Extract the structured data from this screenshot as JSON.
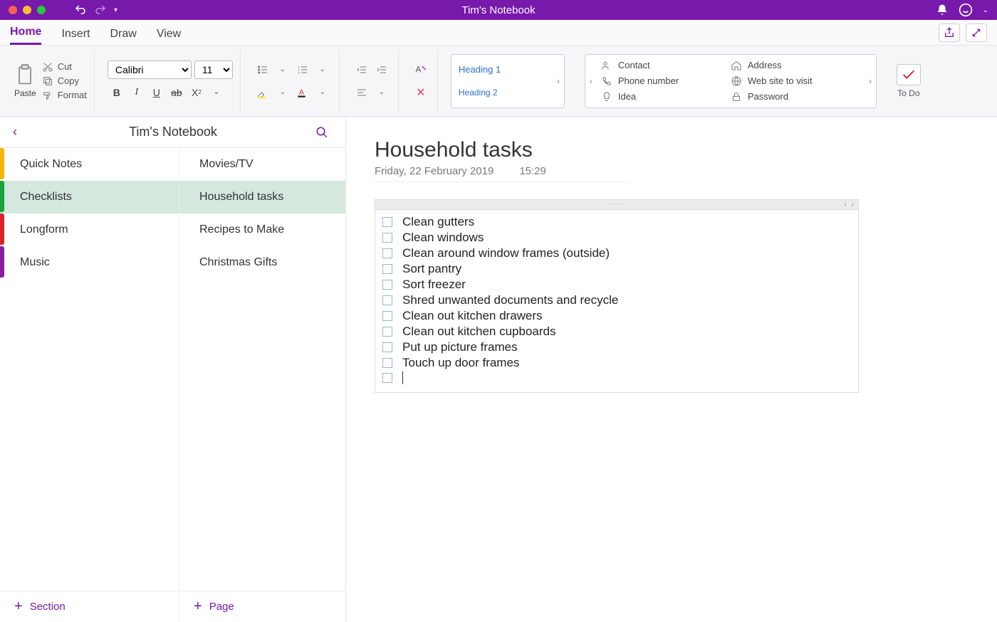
{
  "title": "Tim's Notebook",
  "tabs": {
    "home": "Home",
    "insert": "Insert",
    "draw": "Draw",
    "view": "View"
  },
  "clipboard": {
    "paste": "Paste",
    "cut": "Cut",
    "copy": "Copy",
    "format": "Format"
  },
  "font": {
    "name": "Calibri",
    "size": "11"
  },
  "headings": {
    "h1": "Heading 1",
    "h2": "Heading 2"
  },
  "tags": {
    "contact": "Contact",
    "phone": "Phone number",
    "idea": "Idea",
    "address": "Address",
    "website": "Web site to visit",
    "password": "Password"
  },
  "todo": "To Do",
  "notebook_name": "Tim's Notebook",
  "sections": [
    {
      "label": "Quick Notes",
      "color": "#f4b700"
    },
    {
      "label": "Checklists",
      "color": "#1aa33a"
    },
    {
      "label": "Longform",
      "color": "#d8232a"
    },
    {
      "label": "Music",
      "color": "#8a1fa0"
    }
  ],
  "pages_list": [
    {
      "label": "Movies/TV"
    },
    {
      "label": "Household tasks"
    },
    {
      "label": "Recipes to Make"
    },
    {
      "label": "Christmas Gifts"
    }
  ],
  "active_section_index": 1,
  "active_page_index": 1,
  "footer": {
    "section": "Section",
    "page": "Page"
  },
  "page": {
    "title": "Household tasks",
    "date": "Friday, 22 February 2019",
    "time": "15:29",
    "tasks": [
      "Clean gutters",
      "Clean windows",
      "Clean around window frames (outside)",
      "Sort pantry",
      "Sort freezer",
      "Shred unwanted documents and recycle",
      "Clean out kitchen drawers",
      "Clean out kitchen cupboards",
      "Put up picture frames",
      "Touch up door frames"
    ]
  }
}
